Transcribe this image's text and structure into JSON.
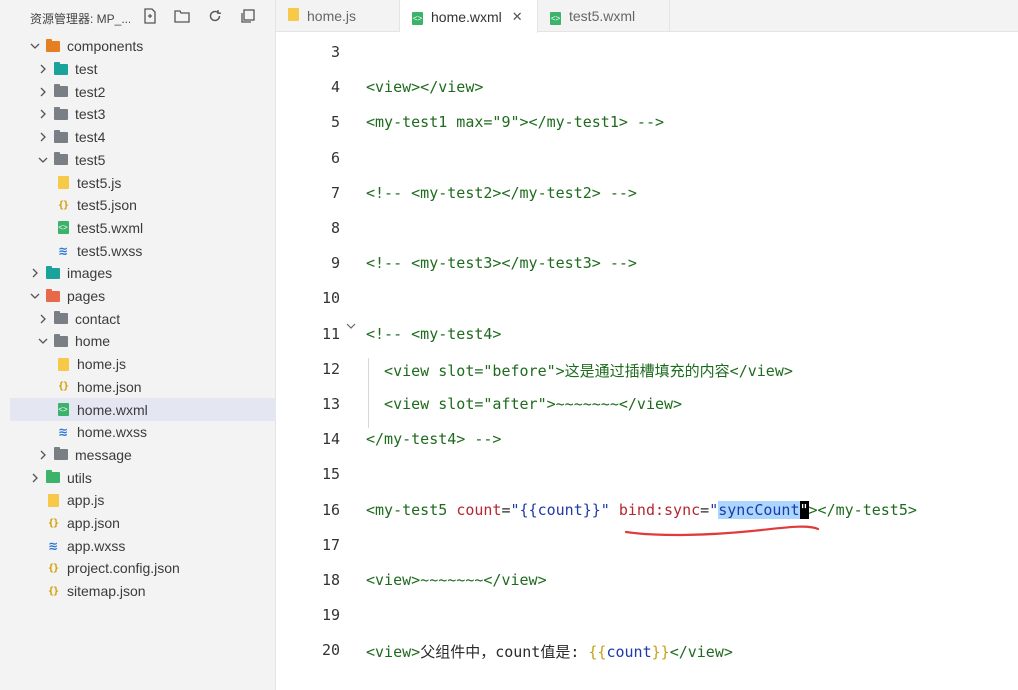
{
  "explorer": {
    "title": "资源管理器: MP_...",
    "tree": [
      {
        "label": "components",
        "type": "folder",
        "color": "#e67e22",
        "level": 0,
        "open": true
      },
      {
        "label": "test",
        "type": "folder",
        "color": "#1aa39a",
        "level": 1,
        "open": false
      },
      {
        "label": "test2",
        "type": "folder",
        "color": "#7a7f86",
        "level": 1,
        "open": false
      },
      {
        "label": "test3",
        "type": "folder",
        "color": "#7a7f86",
        "level": 1,
        "open": false
      },
      {
        "label": "test4",
        "type": "folder",
        "color": "#7a7f86",
        "level": 1,
        "open": false
      },
      {
        "label": "test5",
        "type": "folder",
        "color": "#7a7f86",
        "level": 1,
        "open": true
      },
      {
        "label": "test5.js",
        "type": "js",
        "level": 2
      },
      {
        "label": "test5.json",
        "type": "json",
        "level": 2
      },
      {
        "label": "test5.wxml",
        "type": "wxml",
        "level": 2
      },
      {
        "label": "test5.wxss",
        "type": "wxss",
        "level": 2
      },
      {
        "label": "images",
        "type": "folder",
        "color": "#1aa39a",
        "level": 0,
        "open": false
      },
      {
        "label": "pages",
        "type": "folder",
        "color": "#e8684a",
        "level": 0,
        "open": true
      },
      {
        "label": "contact",
        "type": "folder",
        "color": "#7a7f86",
        "level": 1,
        "open": false
      },
      {
        "label": "home",
        "type": "folder",
        "color": "#7a7f86",
        "level": 1,
        "open": true
      },
      {
        "label": "home.js",
        "type": "js",
        "level": 2
      },
      {
        "label": "home.json",
        "type": "json",
        "level": 2
      },
      {
        "label": "home.wxml",
        "type": "wxml",
        "level": 2,
        "selected": true
      },
      {
        "label": "home.wxss",
        "type": "wxss",
        "level": 2
      },
      {
        "label": "message",
        "type": "folder",
        "color": "#7a7f86",
        "level": 1,
        "open": false
      },
      {
        "label": "utils",
        "type": "folder",
        "color": "#3bb36a",
        "level": 0,
        "open": false
      },
      {
        "label": "app.js",
        "type": "js",
        "level": 0,
        "file": true
      },
      {
        "label": "app.json",
        "type": "json",
        "level": 0,
        "file": true
      },
      {
        "label": "app.wxss",
        "type": "wxss",
        "level": 0,
        "file": true
      },
      {
        "label": "project.config.json",
        "type": "json",
        "level": 0,
        "file": true
      },
      {
        "label": "sitemap.json",
        "type": "json",
        "level": 0,
        "file": true
      }
    ]
  },
  "tabs": [
    {
      "label": "home.js",
      "type": "js",
      "active": false
    },
    {
      "label": "home.wxml",
      "type": "wxml",
      "active": true,
      "close": "✕"
    },
    {
      "label": "test5.wxml",
      "type": "wxml",
      "active": false
    }
  ],
  "editor": {
    "lines": [
      {
        "n": "3",
        "tokens": []
      },
      {
        "n": "4",
        "tokens": [
          [
            "tag",
            "<view></view>"
          ]
        ]
      },
      {
        "n": "5",
        "tokens": [
          [
            "tag",
            "<my-test1 max=\"9\"></my-test1> -->"
          ]
        ]
      },
      {
        "n": "6",
        "tokens": []
      },
      {
        "n": "7",
        "tokens": [
          [
            "tag",
            "<!-- <my-test2></my-test2> -->"
          ]
        ]
      },
      {
        "n": "8",
        "tokens": []
      },
      {
        "n": "9",
        "tokens": [
          [
            "tag",
            "<!-- <my-test3></my-test3> -->"
          ]
        ]
      },
      {
        "n": "10",
        "tokens": []
      },
      {
        "n": "11",
        "fold": true,
        "tokens": [
          [
            "tag",
            "<!-- <my-test4>"
          ]
        ]
      },
      {
        "n": "12",
        "tokens": [
          [
            "tag",
            "  <view slot=\"before\">这是通过插槽填充的内容</view>"
          ]
        ]
      },
      {
        "n": "13",
        "tokens": [
          [
            "tag",
            "  <view slot=\"after\">~~~~~~~</view>"
          ]
        ]
      },
      {
        "n": "14",
        "tokens": [
          [
            "tag",
            "</my-test4> -->"
          ]
        ]
      },
      {
        "n": "15",
        "tokens": []
      },
      {
        "n": "16",
        "tokens": [
          [
            "tag",
            "<my-test5 "
          ],
          [
            "attr",
            "count"
          ],
          [
            "plain",
            "="
          ],
          [
            "str",
            "\"{{count}}\""
          ],
          [
            "plain",
            " "
          ],
          [
            "attr",
            "bind:sync"
          ],
          [
            "plain",
            "="
          ],
          [
            "str",
            "\""
          ],
          [
            "sel",
            "syncCount"
          ],
          [
            "cursor",
            "\""
          ],
          [
            "tag",
            "></my-test5>"
          ]
        ]
      },
      {
        "n": "17",
        "tokens": []
      },
      {
        "n": "18",
        "tokens": [
          [
            "tag",
            "<view>~~~~~~~</view>"
          ]
        ]
      },
      {
        "n": "19",
        "tokens": []
      },
      {
        "n": "20",
        "tokens": [
          [
            "tag",
            "<view>"
          ],
          [
            "plain",
            "父组件中，count值是: "
          ],
          [
            "brace",
            "{{"
          ],
          [
            "str",
            "count"
          ],
          [
            "brace",
            "}}"
          ],
          [
            "tag",
            "</view>"
          ]
        ]
      }
    ]
  }
}
